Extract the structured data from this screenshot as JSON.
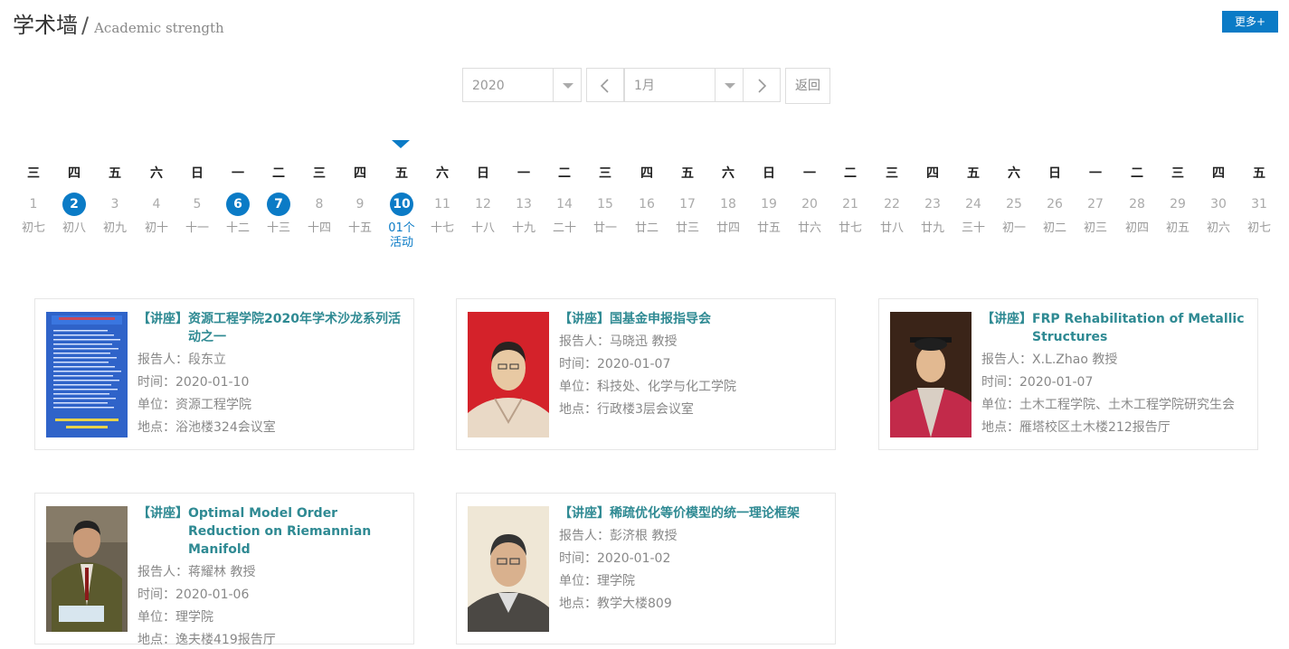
{
  "header": {
    "title_cn": "学术墙",
    "slash": "/",
    "title_en": "Academic strength",
    "more_label": "更多+"
  },
  "controls": {
    "year_value": "2020",
    "month_value": "1月",
    "back_label": "返回"
  },
  "calendar": {
    "days": [
      {
        "wk": "三",
        "d": "1",
        "lunar": "初七"
      },
      {
        "wk": "四",
        "d": "2",
        "lunar": "初八",
        "hl": true
      },
      {
        "wk": "五",
        "d": "3",
        "lunar": "初九"
      },
      {
        "wk": "六",
        "d": "4",
        "lunar": "初十"
      },
      {
        "wk": "日",
        "d": "5",
        "lunar": "十一"
      },
      {
        "wk": "一",
        "d": "6",
        "lunar": "十二",
        "hl": true
      },
      {
        "wk": "二",
        "d": "7",
        "lunar": "十三",
        "hl": true
      },
      {
        "wk": "三",
        "d": "8",
        "lunar": "十四"
      },
      {
        "wk": "四",
        "d": "9",
        "lunar": "十五"
      },
      {
        "wk": "五",
        "d": "10",
        "lunar": "01个活动",
        "hl": true,
        "active": true
      },
      {
        "wk": "六",
        "d": "11",
        "lunar": "十七"
      },
      {
        "wk": "日",
        "d": "12",
        "lunar": "十八"
      },
      {
        "wk": "一",
        "d": "13",
        "lunar": "十九"
      },
      {
        "wk": "二",
        "d": "14",
        "lunar": "二十"
      },
      {
        "wk": "三",
        "d": "15",
        "lunar": "廿一"
      },
      {
        "wk": "四",
        "d": "16",
        "lunar": "廿二"
      },
      {
        "wk": "五",
        "d": "17",
        "lunar": "廿三"
      },
      {
        "wk": "六",
        "d": "18",
        "lunar": "廿四"
      },
      {
        "wk": "日",
        "d": "19",
        "lunar": "廿五"
      },
      {
        "wk": "一",
        "d": "20",
        "lunar": "廿六"
      },
      {
        "wk": "二",
        "d": "21",
        "lunar": "廿七"
      },
      {
        "wk": "三",
        "d": "22",
        "lunar": "廿八"
      },
      {
        "wk": "四",
        "d": "23",
        "lunar": "廿九"
      },
      {
        "wk": "五",
        "d": "24",
        "lunar": "三十"
      },
      {
        "wk": "六",
        "d": "25",
        "lunar": "初一"
      },
      {
        "wk": "日",
        "d": "26",
        "lunar": "初二"
      },
      {
        "wk": "一",
        "d": "27",
        "lunar": "初三"
      },
      {
        "wk": "二",
        "d": "28",
        "lunar": "初四"
      },
      {
        "wk": "三",
        "d": "29",
        "lunar": "初五"
      },
      {
        "wk": "四",
        "d": "30",
        "lunar": "初六"
      },
      {
        "wk": "五",
        "d": "31",
        "lunar": "初七"
      }
    ]
  },
  "events": [
    {
      "tag": "【讲座】",
      "title": "资源工程学院2020年学术沙龙系列活动之一",
      "reporter": "报告人：段东立",
      "time": "时间：2020-01-10",
      "unit": "单位：资源工程学院",
      "place": "地点：浴池楼324会议室"
    },
    {
      "tag": "【讲座】",
      "title": "国基金申报指导会",
      "reporter": "报告人：马晓迅 教授",
      "time": "时间：2020-01-07",
      "unit": "单位：科技处、化学与化工学院",
      "place": "地点：行政楼3层会议室"
    },
    {
      "tag": "【讲座】",
      "title": "FRP Rehabilitation of Metallic Structures",
      "reporter": "报告人：X.L.Zhao 教授",
      "time": "时间：2020-01-07",
      "unit": "单位：土木工程学院、土木工程学院研究生会",
      "place": "地点：雁塔校区土木楼212报告厅"
    },
    {
      "tag": "【讲座】",
      "title": "Optimal Model Order Reduction on Riemannian Manifold",
      "reporter": "报告人：蒋耀林 教授",
      "time": "时间：2020-01-06",
      "unit": "单位：理学院",
      "place": "地点：逸夫楼419报告厅"
    },
    {
      "tag": "【讲座】",
      "title": "稀疏优化等价模型的统一理论框架",
      "reporter": "报告人：彭济根 教授",
      "time": "时间：2020-01-02",
      "unit": "单位：理学院",
      "place": "地点：教学大楼809"
    }
  ]
}
